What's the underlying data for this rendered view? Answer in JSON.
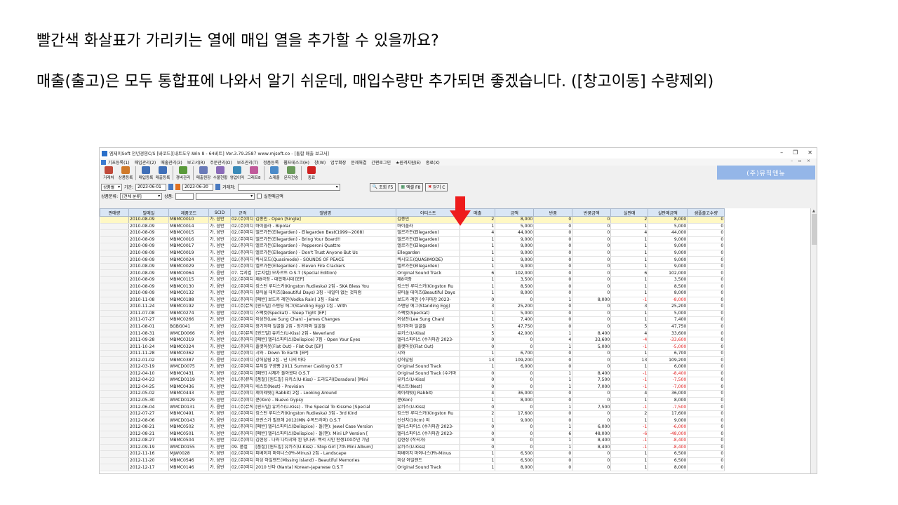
{
  "slide": {
    "question": "빨간색 화살표가 가리키는 열에 매입 열을 추가할 수 있을까요?",
    "note": "매출(출고)은 모두 통합표에 나와서 알기 쉬운데, 매입수량만 추가되면 좋겠습니다. ([창고이동] 수량제외)"
  },
  "window": {
    "title": "엠제이Soft 천년경영C/S [바코드][내트도우:Win 8 - 64비트] Ver.3.79.2587        www.mjsoft.co - [통합 매출 보고서]",
    "controls": [
      "–",
      "❐",
      "✕"
    ],
    "mdi_controls": "– ▫ ×"
  },
  "menu": [
    "기초등록(1)",
    "매입관리(2)",
    "매출관리(3)",
    "보고서(R)",
    "주문관리(O)",
    "보조관리(T)",
    "정품등록",
    "웹프데스크(H)",
    "창(W)",
    "업무확장",
    "문제해결",
    "간편로그인",
    "★원격지원(E)",
    "종료(X)"
  ],
  "toolbar": {
    "buttons": [
      {
        "label": "거래처",
        "color": "#c04a3a"
      },
      {
        "label": "상품등록",
        "color": "#d07a2a"
      },
      {
        "label": "매입등록",
        "color": "#3f6fb8"
      },
      {
        "label": "매출등록",
        "color": "#3f6fb8"
      },
      {
        "label": "경비관리",
        "color": "#5a9a3a"
      },
      {
        "label": "매출원장",
        "color": "#6a7ab8"
      },
      {
        "label": "수불현황",
        "color": "#8a6ab8"
      },
      {
        "label": "영업이익",
        "color": "#3a8ab8"
      },
      {
        "label": "그래프8",
        "color": "#c05a9a"
      },
      {
        "label": "스케쥴",
        "color": "#4a8ac8"
      },
      {
        "label": "문자전송",
        "color": "#6a9a5a"
      },
      {
        "label": "종료",
        "color": "#d02020"
      }
    ],
    "company": "(주)뮤직앤뉴"
  },
  "filters": {
    "period_type": "상품별",
    "period_label": "기간:",
    "date_from": "2023-06-01",
    "date_to": "2023-06-30",
    "client_label": "거래처:",
    "category_label": "상품분류:",
    "category_value": "[전체 분류]",
    "product_label": "상품:",
    "real_sales_label": "실판매금액",
    "query_button": "조회 F5",
    "excel_button": "엑셀 F8",
    "close_button": "닫기 C"
  },
  "table": {
    "columns": [
      "판매량",
      "발매일",
      "제품코드",
      "SCID",
      "규격",
      "앨범명",
      "아티스트",
      "매출",
      "금액",
      "반품",
      "반품금액",
      "실판매",
      "실판매금액",
      "샘플출고수량"
    ],
    "rows": [
      [
        "",
        "2010-08-09",
        "MBMC0010",
        "가. 음반",
        "02.(주)미디",
        "김종민 - Open [Single]",
        "김종민",
        "2",
        "8,000",
        "0",
        "0",
        "2",
        "8,000",
        "0"
      ],
      [
        "",
        "2010-08-09",
        "MBMC0014",
        "가. 음반",
        "02.(주)미디",
        "바이폴라 - Bipolar",
        "바이폴라",
        "1",
        "5,000",
        "0",
        "0",
        "1",
        "5,000",
        "0"
      ],
      [
        "",
        "2010-08-09",
        "MBMC0015",
        "가. 음반",
        "02.(주)미디",
        "엘르가든(Ellegarden) - Ellegarden Best(1999~2008)",
        "엘르가든(Ellegarden)",
        "4",
        "44,000",
        "0",
        "0",
        "4",
        "44,000",
        "0"
      ],
      [
        "",
        "2010-08-09",
        "MBMC0016",
        "가. 음반",
        "02.(주)미디",
        "엘르가든(Ellegarden) - Bring Your Board!!",
        "엘르가든(Ellegarden)",
        "1",
        "9,000",
        "0",
        "0",
        "1",
        "9,000",
        "0"
      ],
      [
        "",
        "2010-08-09",
        "MBMC0017",
        "가. 음반",
        "02.(주)미디",
        "엘르가든(Ellegarden) - Pepperoni Quattro",
        "엘르가든(Ellegarden)",
        "1",
        "9,000",
        "0",
        "0",
        "1",
        "9,000",
        "0"
      ],
      [
        "",
        "2010-08-09",
        "MBMC0019",
        "가. 음반",
        "02.(주)미디",
        "엘르가든(Ellegarden) - Don't Trust Anyone But Us",
        "Ellegarden",
        "1",
        "9,000",
        "0",
        "0",
        "1",
        "9,000",
        "0"
      ],
      [
        "",
        "2010-08-09",
        "MBMC0024",
        "가. 음반",
        "02.(주)미디",
        "콰시모드(Quasimode) - SOUNDS OF PEACE",
        "콰시모드(QUASIMODE)",
        "1",
        "9,000",
        "0",
        "0",
        "1",
        "9,000",
        "0"
      ],
      [
        "",
        "2010-08-09",
        "MBMC0029",
        "가. 음반",
        "02.(주)미디",
        "엘르가든(Ellegarden) - Eleven Fire Crackers",
        "엘르가든(Ellegarden)",
        "1",
        "9,000",
        "0",
        "0",
        "1",
        "9,000",
        "0"
      ],
      [
        "",
        "2010-08-09",
        "MBMC0064",
        "가. 음반",
        "07. 뮤지컬",
        "[뮤지컬] 모차르트 O.S.T (Special Edition)",
        "Original Sound Track",
        "6",
        "102,000",
        "0",
        "0",
        "6",
        "102,000",
        "0"
      ],
      [
        "",
        "2010-08-09",
        "MBMC0115",
        "가. 음반",
        "02.(주)미디",
        "제8극장 - 대합해시대 [EP]",
        "제8극장",
        "1",
        "3,500",
        "0",
        "0",
        "1",
        "3,500",
        "0"
      ],
      [
        "",
        "2010-08-09",
        "MBMC0130",
        "가. 음반",
        "02.(주)미디",
        "킹스턴 루디스카(Kingston Rudieska) 2집 - SKA Bless You",
        "킹스턴 루디스카(Kingston Ru",
        "1",
        "8,500",
        "0",
        "0",
        "1",
        "8,500",
        "0"
      ],
      [
        "",
        "2010-08-09",
        "MBMC0132",
        "가. 음반",
        "02.(주)미디",
        "뷰티풀 데이즈(Beautiful Days) 3집 - 내일이 없는 것처럼",
        "뷰티풀 데이즈(Beautiful Days",
        "1",
        "8,000",
        "0",
        "0",
        "1",
        "8,000",
        "0"
      ],
      [
        "",
        "2010-11-08",
        "MBMC0188",
        "가. 음반",
        "02.(주)미디",
        "[폐반] 보드카 레인(Vodka Rain) 3집 - Faint",
        "보드카 레인 (수거마감 2023-",
        "0",
        "0",
        "1",
        "8,000",
        "-1",
        "-8,000",
        "0"
      ],
      [
        "",
        "2010-11-24",
        "MBMC0192",
        "가. 음반",
        "01.(주)뮤직",
        "[윈드밀] 스탠딩 에그(Standing Egg) 1집 - With",
        "스탠딩 에그(Standing Egg)",
        "3",
        "25,200",
        "0",
        "0",
        "3",
        "25,200",
        "0"
      ],
      [
        "",
        "2011-07-08",
        "MBMC0274",
        "가. 음반",
        "02.(주)미디",
        "스팩컷(Speckat) - Sleep Tight [EP]",
        "스팩컷(Speckat)",
        "1",
        "5,000",
        "0",
        "0",
        "1",
        "5,000",
        "0"
      ],
      [
        "",
        "2011-07-27",
        "MBMC0266",
        "가. 음반",
        "02.(주)미디",
        "이성찬(Lee Sung Chan) - James Changes",
        "이성찬(Lee Sung Chan)",
        "1",
        "7,400",
        "0",
        "0",
        "1",
        "7,400",
        "0"
      ],
      [
        "",
        "2011-08-01",
        "BGBG041",
        "가. 음반",
        "02.(주)미디",
        "장기하와 얼굴들 2집 - 장기하와 얼굴들",
        "장기하와 얼굴들",
        "5",
        "47,750",
        "0",
        "0",
        "5",
        "47,750",
        "0"
      ],
      [
        "",
        "2011-08-31",
        "WMCD0066",
        "가. 음반",
        "01.(주)뮤직",
        "[윈드밀] 유키스(U-Kiss) 2집 - Neverland",
        "유키스(U-Kiss)",
        "5",
        "42,000",
        "1",
        "8,400",
        "4",
        "33,600",
        "0"
      ],
      [
        "",
        "2011-09-28",
        "MBMC0319",
        "가. 음반",
        "02.(주)미디",
        "[폐반] 델리스파이스(Delispice) 7집 - Open Your Eyes",
        "델리스파이스 (수거마감 2023-",
        "0",
        "0",
        "4",
        "33,600",
        "-4",
        "-33,600",
        "0"
      ],
      [
        "",
        "2011-10-24",
        "MBMC0324",
        "가. 음반",
        "02.(주)미디",
        "플랫아웃(Flat Out) - Flat Out [EP]",
        "플랫아웃(Flat Out)",
        "0",
        "0",
        "1",
        "5,000",
        "-1",
        "-5,000",
        "0"
      ],
      [
        "",
        "2011-11-28",
        "MBMC0362",
        "가. 음반",
        "02.(주)미디",
        "시와 - Down To Earth [EP]",
        "시와",
        "1",
        "6,700",
        "0",
        "0",
        "1",
        "6,700",
        "0"
      ],
      [
        "",
        "2012-01-02",
        "MBMC0387",
        "가. 음반",
        "02.(주)미디",
        "강허달림 2집 - 넌 나의 바다",
        "강허달림",
        "13",
        "109,200",
        "0",
        "0",
        "13",
        "109,200",
        "0"
      ],
      [
        "",
        "2012-03-19",
        "WMCD0075",
        "가. 음반",
        "02.(주)미디",
        "뮤지컬 구름빵 2011 Summer Casting O.S.T",
        "Original Sound Track",
        "1",
        "6,000",
        "0",
        "0",
        "1",
        "6,000",
        "0"
      ],
      [
        "",
        "2012-04-10",
        "MBMC0431",
        "가. 음반",
        "02.(주)미디",
        "[폐반] 시체가 돌아왔다 O.S.T",
        "Original Sound Track (수거마",
        "0",
        "0",
        "1",
        "8,400",
        "-1",
        "-8,400",
        "0"
      ],
      [
        "",
        "2012-04-23",
        "WMCD0119",
        "가. 음반",
        "01.(주)뮤직",
        "[품절] [윈드밀] 유키스(U-Kiss) - 도라도라(Doradora) [Mini",
        "유키스(U-Kiss)",
        "0",
        "0",
        "1",
        "7,500",
        "-1",
        "-7,500",
        "0"
      ],
      [
        "",
        "2012-04-25",
        "MBMC0436",
        "가. 음반",
        "02.(주)미디",
        "네스트(Nest) - Provision",
        "네스트(Nest)",
        "0",
        "0",
        "1",
        "7,000",
        "-1",
        "-7,000",
        "0"
      ],
      [
        "",
        "2012-05-02",
        "MBMC0443",
        "가. 음반",
        "02.(주)미디",
        "제이레빗(J Rabbit) 2집 - Looking Around",
        "제이레빗(J Rabbit)",
        "4",
        "36,000",
        "0",
        "0",
        "4",
        "36,000",
        "0"
      ],
      [
        "",
        "2012-05-30",
        "WMCD0129",
        "가. 음반",
        "02.(주)미디",
        "쿤(Kon) - Nuevo Gypsy",
        "쿤(Kon)",
        "1",
        "8,000",
        "0",
        "0",
        "1",
        "8,000",
        "0"
      ],
      [
        "",
        "2012-06-04",
        "WMCD0131",
        "가. 음반",
        "01.(주)뮤직",
        "[윈드밀] 유키스(U-Kiss) - The Special To Kissme [Special",
        "유키스(U-Kiss)",
        "0",
        "0",
        "1",
        "7,500",
        "-1",
        "-7,500",
        "0"
      ],
      [
        "",
        "2012-07-27",
        "MBMC0491",
        "가. 음반",
        "02.(주)미디",
        "킹스턴 루디스카(Kingston Rudieska) 3집 - 3rd Kind",
        "킹스턴 루디스카(Kingston Ru",
        "2",
        "17,600",
        "0",
        "0",
        "2",
        "17,600",
        "0"
      ],
      [
        "",
        "2012-08-06",
        "WMCD0143",
        "가. 음반",
        "02.(주)미디",
        "요란스가 필요해 2012(MN 수목드라마) O.S.T",
        "신선치(10cm) 외",
        "1",
        "9,000",
        "0",
        "0",
        "1",
        "9,000",
        "0"
      ],
      [
        "",
        "2012-08-21",
        "MBMC0502",
        "가. 음반",
        "02.(주)미디",
        "[폐반] 델리스파이스(Delispice) - 돌(맨): Jewel Case Version",
        "델리스파이스 (수거마감 2023-",
        "0",
        "0",
        "1",
        "6,000",
        "-1",
        "-6,000",
        "0"
      ],
      [
        "",
        "2012-08-21",
        "MBMC0501",
        "가. 음반",
        "02.(주)미디",
        "[폐반] 델리스파이스(Delispice) - 돌(맨): Mini LP Version [",
        "델리스파이스 (수거마감 2023-",
        "0",
        "0",
        "6",
        "48,000",
        "-6",
        "-48,000",
        "0"
      ],
      [
        "",
        "2012-08-27",
        "MBMC0504",
        "가. 음반",
        "02.(주)미디",
        "김현성 - 나와 나타샤와 흰 당나귀: 백석 시인 탄생100주년 기념",
        "김현성 (작곡가)",
        "0",
        "0",
        "1",
        "8,400",
        "-1",
        "-8,400",
        "0"
      ],
      [
        "",
        "2012-09-19",
        "WMCD0155",
        "가. 음반",
        "09. 품절",
        "[품절] [윈드밀] 유키스(U-Kiss) - Stop Girl [7th Mini Album]",
        "유키스(U-Kiss)",
        "0",
        "0",
        "1",
        "8,400",
        "-1",
        "-8,400",
        "0"
      ],
      [
        "",
        "2012-11-16",
        "MJW0028",
        "가. 음반",
        "02.(주)미디",
        "피베이치 마이너스(Ph-Minus) 2집 - Landscape",
        "피베이치 마이너스(Ph-Minus",
        "1",
        "6,500",
        "0",
        "0",
        "1",
        "6,500",
        "0"
      ],
      [
        "",
        "2012-11-20",
        "MBMC0546",
        "가. 음반",
        "02.(주)미디",
        "미싱 아일랜드(Missing Island) - Beautiful Memories",
        "미싱 아일랜드",
        "1",
        "6,500",
        "0",
        "0",
        "1",
        "6,500",
        "0"
      ],
      [
        "",
        "2012-12-17",
        "MBMC0146",
        "가. 음반",
        "02.(주)미디",
        "2010 난타 (Nanta) Korean-Japanese O.S.T",
        "Original Sound Track",
        "1",
        "8,000",
        "0",
        "0",
        "1",
        "8,000",
        "0"
      ]
    ]
  },
  "colors": {
    "header_bg": "#d9e6f5",
    "selected_row": "#fff8c4",
    "negative": "#e02020",
    "company_badge": "#94b6e8",
    "arrow": "#ee1c1c"
  }
}
